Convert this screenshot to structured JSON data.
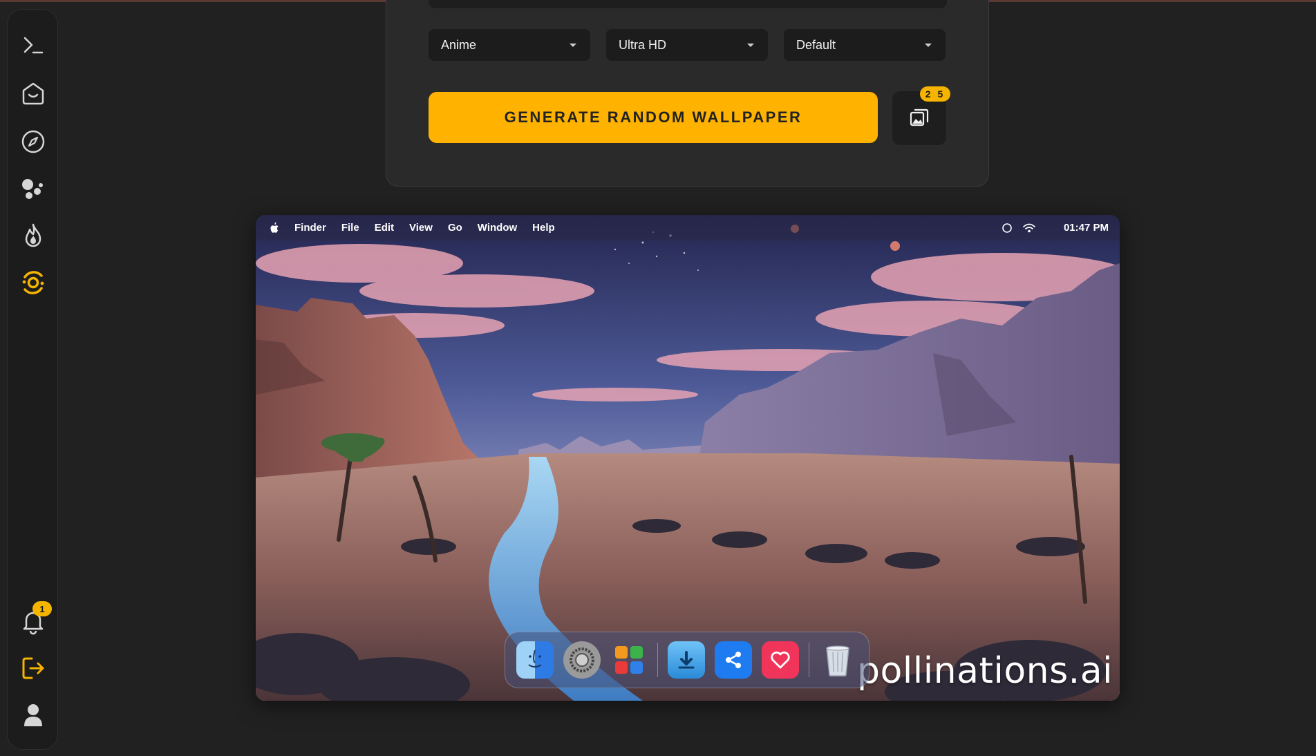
{
  "sidebar": {
    "items": [
      {
        "name": "terminal-icon"
      },
      {
        "name": "home-icon"
      },
      {
        "name": "compass-icon"
      },
      {
        "name": "bubbles-icon"
      },
      {
        "name": "flame-icon"
      },
      {
        "name": "wallpaper-generator-icon",
        "active": true
      }
    ],
    "notifications_badge": "1",
    "bottom_items": [
      {
        "name": "bell-icon"
      },
      {
        "name": "logout-icon"
      },
      {
        "name": "user-icon"
      }
    ],
    "accent_color": "#f5b400"
  },
  "form": {
    "style_select": "Anime",
    "quality_select": "Ultra HD",
    "ratio_select": "Default",
    "generate_label": "GENERATE RANDOM WALLPAPER",
    "gallery_badge": "2 5",
    "button_color": "#ffb300"
  },
  "preview": {
    "menubar": {
      "items": [
        "Finder",
        "File",
        "Edit",
        "View",
        "Go",
        "Window",
        "Help"
      ],
      "clock": "01:47 PM"
    },
    "watermark": "pollinations.ai",
    "dock": [
      "finder-icon",
      "settings-icon",
      "launchpad-icon",
      "downloads-icon",
      "share-icon",
      "favorite-icon",
      "trash-icon"
    ]
  }
}
